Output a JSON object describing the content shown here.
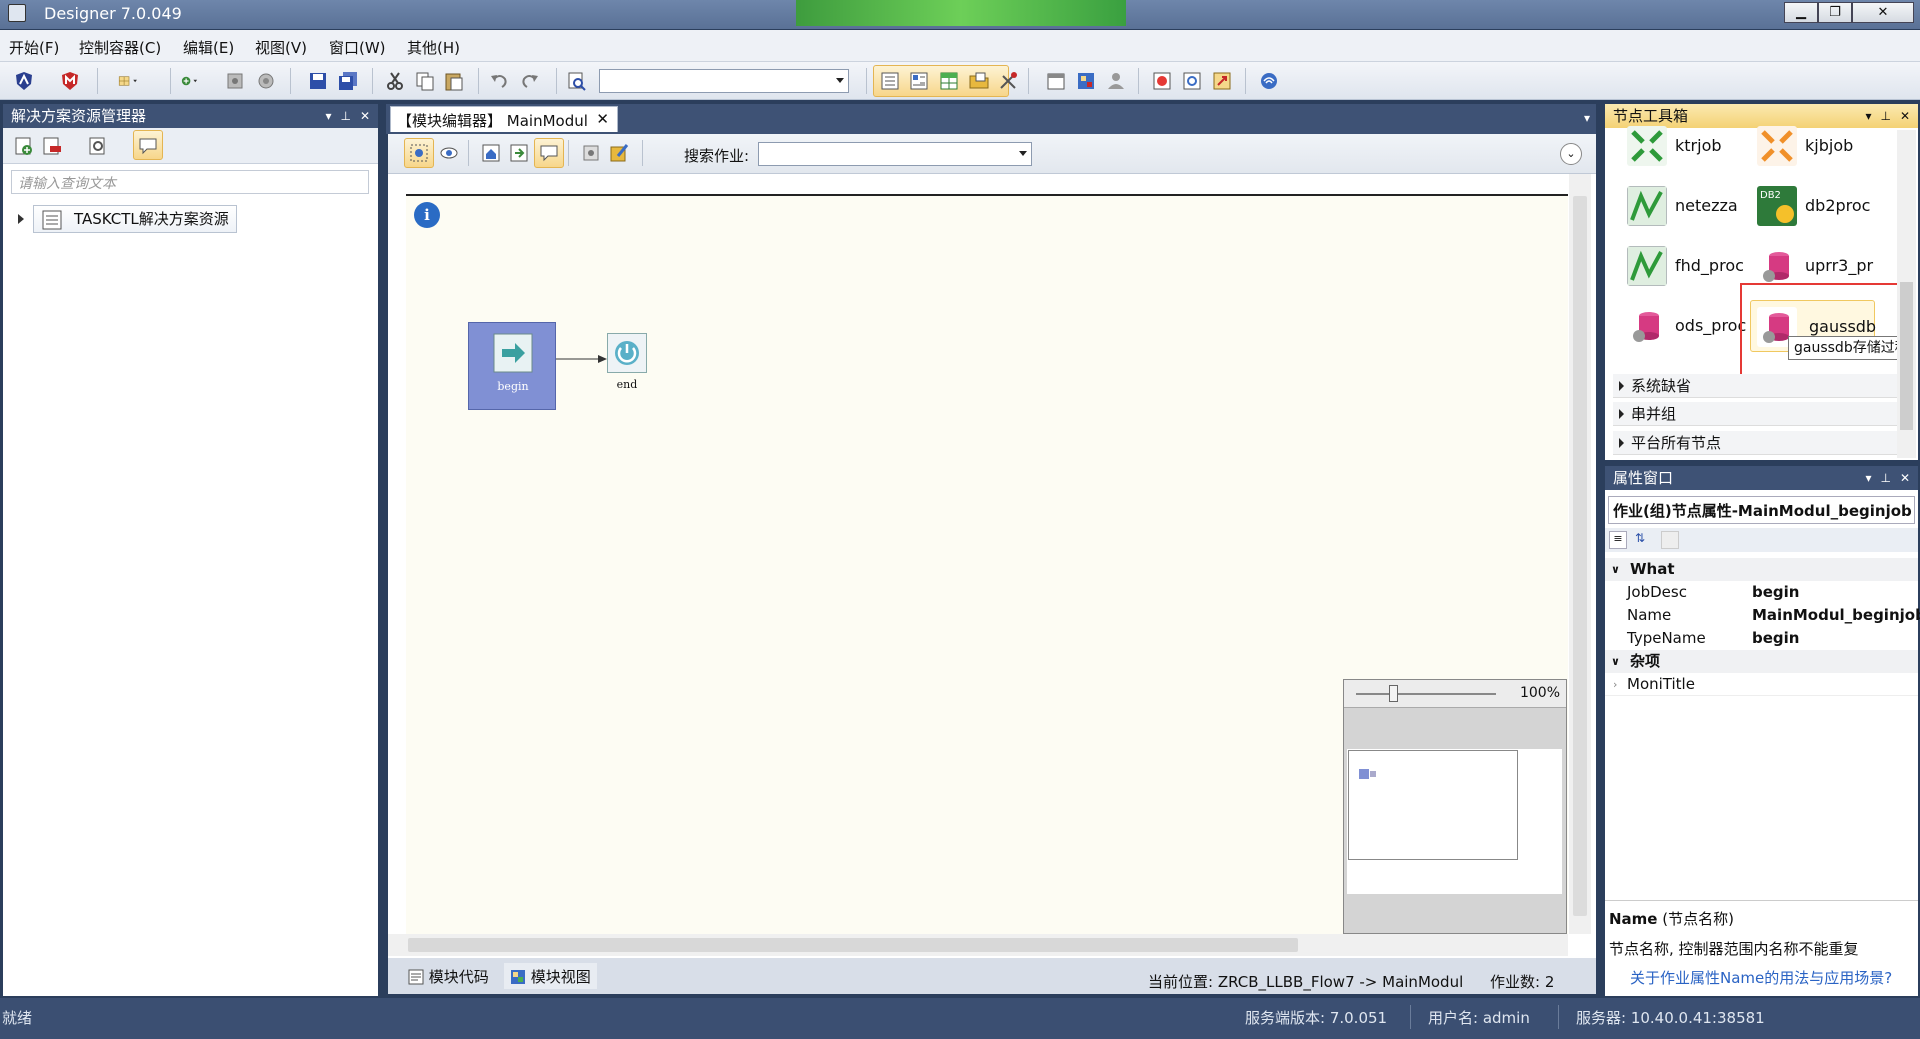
{
  "window": {
    "title": "Designer 7.0.049",
    "min_btn": "▁",
    "restore_btn": "❐",
    "close_btn": "✕"
  },
  "menu": [
    "开始(F)",
    "控制容器(C)",
    "编辑(E)",
    "视图(V)",
    "窗口(W)",
    "其他(H)"
  ],
  "left_panel": {
    "title": "解决方案资源管理器",
    "search_placeholder": "请输入查询文本",
    "tree_root": "TASKCTL解决方案资源"
  },
  "editor": {
    "tab_label": "【模块编辑器】 MainModul",
    "search_label": "搜索作业:",
    "node_begin": "begin",
    "node_end": "end",
    "zoom": "100%",
    "bottom_tab_code": "模块代码",
    "bottom_tab_view": "模块视图",
    "location": "当前位置:  ZRCB_LLBB_Flow7 -> MainModul",
    "job_count": "作业数:  2"
  },
  "toolbox": {
    "title": "节点工具箱",
    "tools": [
      {
        "name": "ktrjob",
        "icon": "ktrjob-icon"
      },
      {
        "name": "kjbjob",
        "icon": "kjbjob-icon"
      },
      {
        "name": "netezza",
        "icon": "netezza-icon"
      },
      {
        "name": "db2proc",
        "icon": "db2proc-icon"
      },
      {
        "name": "fhd_proc",
        "icon": "fhd-proc-icon"
      },
      {
        "name": "uprr3_pr",
        "icon": "uprr3-proc-icon"
      },
      {
        "name": "ods_proc",
        "icon": "ods-proc-icon"
      },
      {
        "name": "gaussdb",
        "icon": "gaussdb-icon"
      }
    ],
    "tooltip": "gaussdb存储过程",
    "sections": [
      "系统缺省",
      "串并组",
      "平台所有节点"
    ]
  },
  "properties": {
    "title": "属性窗口",
    "object": "作业(组)节点属性-MainModul_beginjob",
    "categories": [
      {
        "name": "What",
        "rows": [
          {
            "key": "JobDesc",
            "value": "begin"
          },
          {
            "key": "Name",
            "value": "MainModul_beginjob"
          },
          {
            "key": "TypeName",
            "value": "begin"
          }
        ]
      },
      {
        "name": "杂项",
        "rows": [
          {
            "key": "MoniTitle",
            "value": ""
          }
        ]
      }
    ],
    "desc_title": "Name",
    "desc_title_suffix": "(节点名称)",
    "desc_text": "节点名称, 控制器范围内名称不能重复",
    "desc_link": "关于作业属性Name的用法与应用场景?"
  },
  "status": {
    "ready": "就绪",
    "server_version": "服务端版本: 7.0.051",
    "user": "用户名: admin",
    "server": "服务器: 10.40.0.41:38581"
  },
  "colors": {
    "accent": "#3e5275",
    "highlight": "#e53935",
    "node_fill": "#8090d4"
  }
}
